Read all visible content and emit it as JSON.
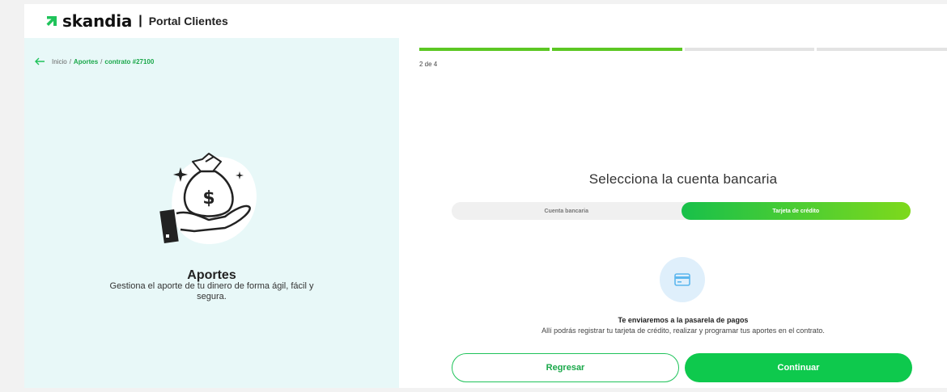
{
  "header": {
    "brand": "skandia",
    "separator": "|",
    "portal": "Portal Clientes"
  },
  "breadcrumb": {
    "items": [
      {
        "label": "Inicio",
        "active": false
      },
      {
        "label": "Aportes",
        "active": true
      },
      {
        "label": "contrato #27100",
        "active": true
      }
    ],
    "separator": "/"
  },
  "intro": {
    "title": "Aportes",
    "description": "Gestiona el aporte de tu dinero de forma ágil, fácil y segura."
  },
  "progress": {
    "current": 2,
    "total": 4,
    "label": "2 de 4"
  },
  "main": {
    "title": "Selecciona la cuenta bancaria",
    "options": [
      {
        "label": "Cuenta bancaria",
        "selected": false
      },
      {
        "label": "Tarjeta de crédito",
        "selected": true
      }
    ],
    "info_title": "Te enviaremos a la pasarela de pagos",
    "info_desc": "Allí podrás registrar tu tarjeta de crédito, realizar y programar tus aportes en el contrato."
  },
  "buttons": {
    "back": "Regresar",
    "next": "Continuar"
  },
  "colors": {
    "accent": "#0ec94d",
    "progress": "#5cc723",
    "left_bg": "#e8f8f8",
    "card_circle": "#dfeffb"
  },
  "icons": {
    "logo": "skandia-arrow-logo",
    "back": "arrow-left-icon",
    "illustration": "money-bag-hand-icon",
    "card": "credit-card-icon"
  }
}
